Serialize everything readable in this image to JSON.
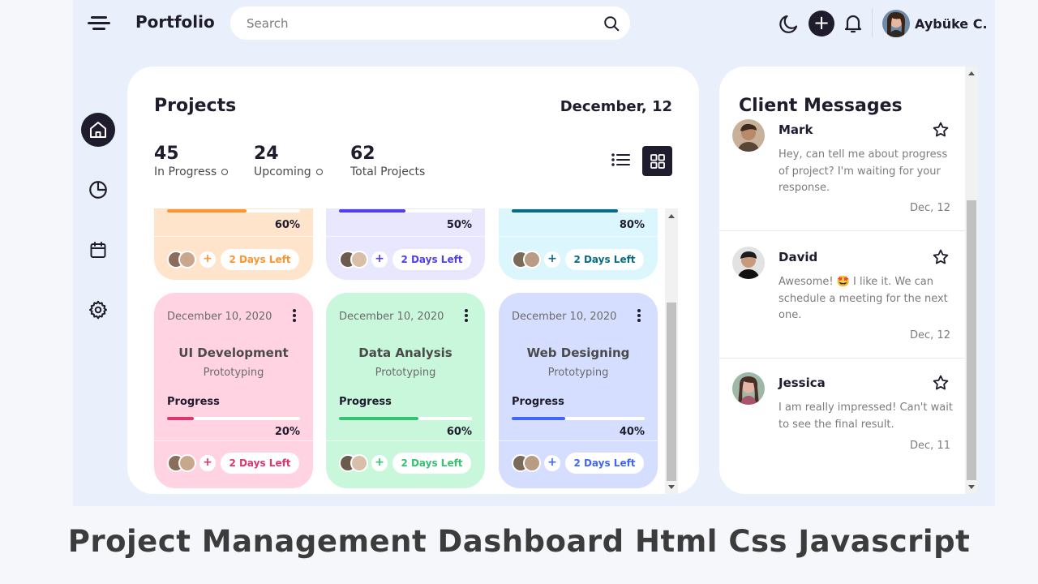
{
  "header": {
    "logo": "Portfolio",
    "search_placeholder": "Search",
    "user_name": "Aybüke C."
  },
  "sidebar": {
    "items": [
      {
        "icon": "home-icon",
        "active": true
      },
      {
        "icon": "pie-chart-icon",
        "active": false
      },
      {
        "icon": "calendar-icon",
        "active": false
      },
      {
        "icon": "settings-icon",
        "active": false
      }
    ]
  },
  "projects": {
    "title": "Projects",
    "date": "December, 12",
    "stats": [
      {
        "value": "45",
        "label": "In Progress"
      },
      {
        "value": "24",
        "label": "Upcoming"
      },
      {
        "value": "62",
        "label": "Total Projects"
      }
    ],
    "top_cards": [
      {
        "percent": "60%",
        "progress": 0.6,
        "days_left": "2 Days Left",
        "bg": "#fee4cb",
        "accent": "#ff942e",
        "text_color": "#ff942e"
      },
      {
        "percent": "50%",
        "progress": 0.5,
        "days_left": "2 Days Left",
        "bg": "#e9e7fd",
        "accent": "#4f3ff0",
        "text_color": "#4f3ff0"
      },
      {
        "percent": "80%",
        "progress": 0.8,
        "days_left": "2 Days Left",
        "bg": "#dbf6fd",
        "accent": "#096c86",
        "text_color": "#096c86"
      }
    ],
    "bottom_cards": [
      {
        "date": "December 10, 2020",
        "name": "UI Development",
        "subtitle": "Prototyping",
        "progress_label": "Progress",
        "percent": "20%",
        "progress": 0.2,
        "days_left": "2 Days Left",
        "bg": "#ffd3e2",
        "accent": "#df3670",
        "text_color": "#df3670"
      },
      {
        "date": "December 10, 2020",
        "name": "Data Analysis",
        "subtitle": "Prototyping",
        "progress_label": "Progress",
        "percent": "60%",
        "progress": 0.6,
        "days_left": "2 Days Left",
        "bg": "#c8f7dc",
        "accent": "#34c471",
        "text_color": "#34c471"
      },
      {
        "date": "December 10, 2020",
        "name": "Web Designing",
        "subtitle": "Prototyping",
        "progress_label": "Progress",
        "percent": "40%",
        "progress": 0.4,
        "days_left": "2 Days Left",
        "bg": "#d5deff",
        "accent": "#4067f9",
        "text_color": "#4067f9"
      }
    ]
  },
  "messages": {
    "title": "Client Messages",
    "items": [
      {
        "name": "Mark",
        "text": "Hey, can tell me about progress of project? I'm waiting for your response.",
        "time": "Dec, 12"
      },
      {
        "name": "David",
        "text": "Awesome! 🤩 I like it. We can schedule a meeting for the next one.",
        "time": "Dec, 12"
      },
      {
        "name": "Jessica",
        "text": "I am really impressed! Can't wait to see the final result.",
        "time": "Dec, 11"
      }
    ]
  },
  "caption": "Project Management Dashboard Html Css Javascript"
}
